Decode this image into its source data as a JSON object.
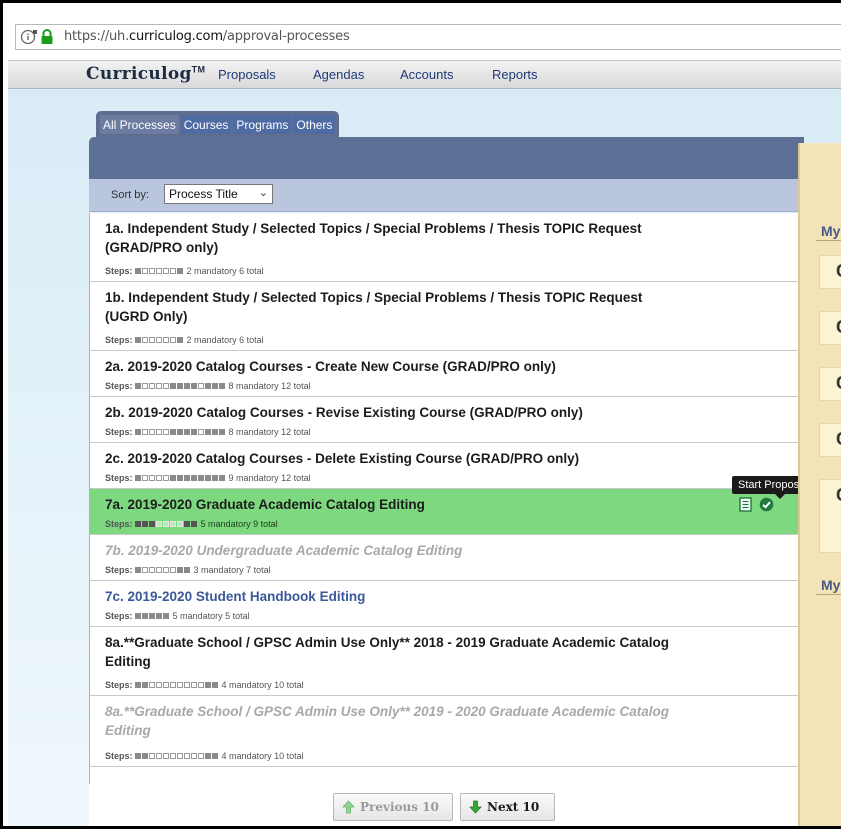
{
  "browser": {
    "url_host_prefix": "https://uh.",
    "url_host": "curriculog.com",
    "url_path": "/approval-processes"
  },
  "nav": {
    "brand": "Curriculog",
    "brand_mark": "TM",
    "items": [
      "Proposals",
      "Agendas",
      "Accounts",
      "Reports"
    ]
  },
  "tabs": [
    "All Processes",
    "Courses",
    "Programs",
    "Others"
  ],
  "sort": {
    "label": "Sort by:",
    "value": "Process Title"
  },
  "steps_label": "Steps:",
  "processes": [
    {
      "title": "1a. Independent Study / Selected Topics / Special Problems / Thesis TOPIC Request (GRAD/PRO only)",
      "steps": "2 mandatory 6 total",
      "pattern": "mooooom",
      "style": "normal"
    },
    {
      "title": "1b. Independent Study / Selected Topics / Special Problems / Thesis TOPIC Request (UGRD Only)",
      "steps": "2 mandatory 6 total",
      "pattern": "mooooom",
      "style": "normal"
    },
    {
      "title": "2a. 2019-2020 Catalog Courses - Create New Course (GRAD/PRO only)",
      "steps": "8 mandatory 12 total",
      "pattern": "moooommmmommm",
      "style": "normal"
    },
    {
      "title": "2b. 2019-2020 Catalog Courses - Revise Existing Course (GRAD/PRO only)",
      "steps": "8 mandatory 12 total",
      "pattern": "moooommmmommm",
      "style": "normal"
    },
    {
      "title": "2c. 2019-2020 Catalog Courses - Delete Existing Course (GRAD/PRO only)",
      "steps": "9 mandatory 12 total",
      "pattern": "moooommmmmmmm",
      "style": "normal"
    },
    {
      "title": "7a. 2019-2020 Graduate Academic Catalog Editing",
      "steps": "5 mandatory 9 total",
      "pattern": "mmmoooomm",
      "style": "active"
    },
    {
      "title": "7b. 2019-2020 Undergraduate Academic Catalog Editing",
      "steps": "3 mandatory 7 total",
      "pattern": "mooooomm",
      "style": "gray"
    },
    {
      "title": "7c. 2019-2020 Student Handbook Editing",
      "steps": "5 mandatory 5 total",
      "pattern": "mmmmm",
      "style": "blue"
    },
    {
      "title": "8a.**Graduate School / GPSC Admin Use Only** 2018 - 2019 Graduate Academic Catalog Editing",
      "steps": "4 mandatory 10 total",
      "pattern": "mmoooooooomm",
      "style": "normal"
    },
    {
      "title": "8a.**Graduate School / GPSC Admin Use Only** 2019 - 2020 Graduate Academic Catalog Editing",
      "steps": "4 mandatory 10 total",
      "pattern": "mmoooooooomm",
      "style": "gray"
    }
  ],
  "tooltip": "Start Proposal",
  "pager": {
    "prev": "Previous 10",
    "next": "Next 10"
  },
  "right_panel": {
    "heading1": "My",
    "heading2": "My",
    "button_letter": "C"
  },
  "colors": {
    "active_row": "#7dd87f",
    "nav_link": "#1e3a78",
    "panel_header": "#5d7196"
  },
  "icons": {
    "info": "info-icon",
    "lock": "lock-icon",
    "document": "document-icon",
    "check": "check-circle-icon",
    "up_arrow": "arrow-up-icon",
    "down_arrow": "arrow-down-icon"
  }
}
